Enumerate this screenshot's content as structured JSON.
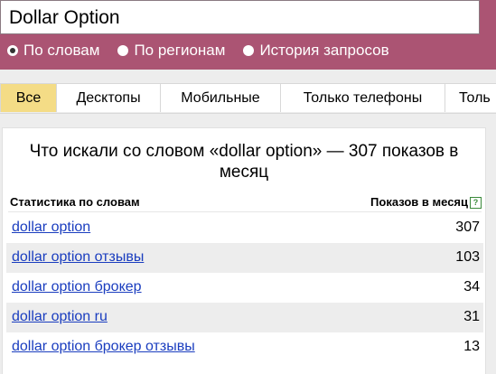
{
  "search": {
    "value": "Dollar Option"
  },
  "modes": [
    {
      "label": "По словам",
      "checked": true
    },
    {
      "label": "По регионам",
      "checked": false
    },
    {
      "label": "История запросов",
      "checked": false
    }
  ],
  "tabs": [
    {
      "label": "Все",
      "active": true
    },
    {
      "label": "Десктопы",
      "active": false
    },
    {
      "label": "Мобильные",
      "active": false
    },
    {
      "label": "Только телефоны",
      "active": false
    },
    {
      "label": "Толь",
      "active": false
    }
  ],
  "stats": {
    "heading": "Что искали со словом «dollar option» — 307 показов в месяц",
    "col_words": "Статистика по словам",
    "col_shows": "Показов в месяц",
    "help": "?",
    "rows": [
      {
        "phrase": "dollar option",
        "count": "307"
      },
      {
        "phrase": "dollar option отзывы",
        "count": "103"
      },
      {
        "phrase": "dollar option брокер",
        "count": "34"
      },
      {
        "phrase": "dollar option ru",
        "count": "31"
      },
      {
        "phrase": "dollar option брокер отзывы",
        "count": "13"
      }
    ]
  }
}
